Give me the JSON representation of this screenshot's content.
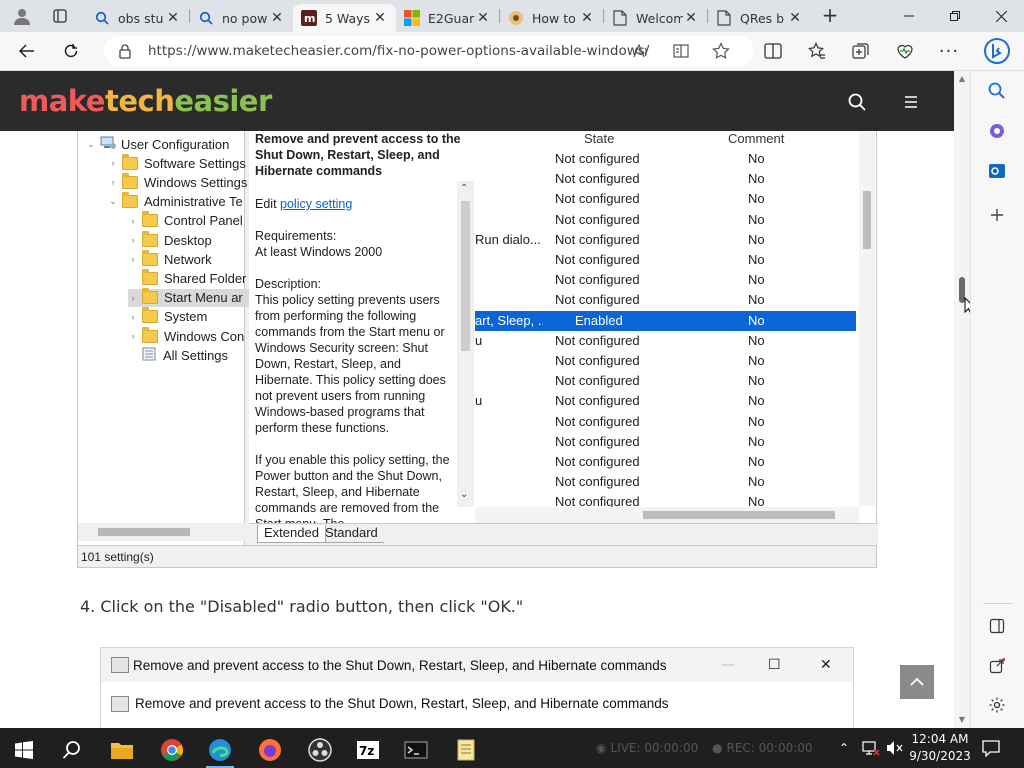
{
  "tabs": [
    {
      "title": "obs stu",
      "icon": "search-icon"
    },
    {
      "title": "no pow",
      "icon": "search-icon"
    },
    {
      "title": "5 Ways",
      "icon": "mte-favicon",
      "active": true
    },
    {
      "title": "E2Guar",
      "icon": "windows-favicon"
    },
    {
      "title": "How to",
      "icon": "site-favicon"
    },
    {
      "title": "Welcom",
      "icon": "page-icon"
    },
    {
      "title": "QRes b",
      "icon": "page-icon"
    }
  ],
  "address": {
    "url": "https://www.maketecheasier.com/fix-no-power-options-available-windows/"
  },
  "site": {
    "logo_make": "make",
    "logo_tech": "tech",
    "logo_easier": "easier",
    "colors": {
      "make": "#ef5b5b",
      "tech": "#f3b442",
      "easier": "#8cc152",
      "header_bg": "#2b2b2b"
    }
  },
  "gpedit": {
    "tree": [
      {
        "label": "User Configuration",
        "level": 0,
        "exp": "⌄",
        "icon": "computer-icon"
      },
      {
        "label": "Software Settings",
        "level": 1,
        "exp": "›"
      },
      {
        "label": "Windows Settings",
        "level": 1,
        "exp": "›"
      },
      {
        "label": "Administrative Te",
        "level": 1,
        "exp": "⌄"
      },
      {
        "label": "Control Panel",
        "level": 2,
        "exp": "›"
      },
      {
        "label": "Desktop",
        "level": 2,
        "exp": "›"
      },
      {
        "label": "Network",
        "level": 2,
        "exp": "›"
      },
      {
        "label": "Shared Folder",
        "level": 2,
        "exp": ""
      },
      {
        "label": "Start Menu ar",
        "level": 2,
        "exp": "›",
        "selected": true
      },
      {
        "label": "System",
        "level": 2,
        "exp": "›"
      },
      {
        "label": "Windows Con",
        "level": 2,
        "exp": "›"
      },
      {
        "label": "All Settings",
        "level": 2,
        "exp": "",
        "icon": "settings-list-icon"
      }
    ],
    "details_title": "Remove and prevent access to the Shut Down, Restart, Sleep, and Hibernate commands",
    "edit_prefix": "Edit ",
    "edit_link": "policy setting",
    "requirements": "Requirements:\nAt least Windows 2000",
    "description": "Description:\nThis policy setting prevents users from performing the following commands from the Start menu or Windows Security screen: Shut Down, Restart, Sleep, and Hibernate. This policy setting does not prevent users from running Windows-based programs that perform these functions.",
    "if_enable": "If you enable this policy setting, the Power button and the Shut Down, Restart, Sleep, and Hibernate commands are removed from the Start menu. The",
    "col_state": "State",
    "col_comment": "Comment",
    "rows": [
      {
        "name": "",
        "state": "Not configured",
        "comment": "No"
      },
      {
        "name": "",
        "state": "Not configured",
        "comment": "No"
      },
      {
        "name": "",
        "state": "Not configured",
        "comment": "No"
      },
      {
        "name": "",
        "state": "Not configured",
        "comment": "No"
      },
      {
        "name": "Run dialo...",
        "state": "Not configured",
        "comment": "No"
      },
      {
        "name": "",
        "state": "Not configured",
        "comment": "No"
      },
      {
        "name": "",
        "state": "Not configured",
        "comment": "No"
      },
      {
        "name": "",
        "state": "Not configured",
        "comment": "No"
      },
      {
        "name": "art, Sleep, ...",
        "state": "Enabled",
        "comment": "No",
        "selected": true
      },
      {
        "name": "u",
        "state": "Not configured",
        "comment": "No"
      },
      {
        "name": "",
        "state": "Not configured",
        "comment": "No"
      },
      {
        "name": "",
        "state": "Not configured",
        "comment": "No"
      },
      {
        "name": "u",
        "state": "Not configured",
        "comment": "No"
      },
      {
        "name": "",
        "state": "Not configured",
        "comment": "No"
      },
      {
        "name": "",
        "state": "Not configured",
        "comment": "No"
      },
      {
        "name": "",
        "state": "Not configured",
        "comment": "No"
      },
      {
        "name": "",
        "state": "Not configured",
        "comment": "No"
      },
      {
        "name": "",
        "state": "Not configured",
        "comment": "No"
      }
    ],
    "tab_extended": "Extended",
    "tab_standard": "Standard",
    "status": "101 setting(s)"
  },
  "article": {
    "step4": "4. Click on the \"Disabled\" radio button, then click \"OK.\""
  },
  "dialog": {
    "title": "Remove and prevent access to the Shut Down, Restart, Sleep, and Hibernate commands",
    "subtitle": "Remove and prevent access to the Shut Down, Restart, Sleep, and Hibernate commands"
  },
  "taskbar": {
    "live": "LIVE: 00:00:00",
    "rec": "REC: 00:00:00",
    "time": "12:04 AM",
    "date": "9/30/2023"
  }
}
